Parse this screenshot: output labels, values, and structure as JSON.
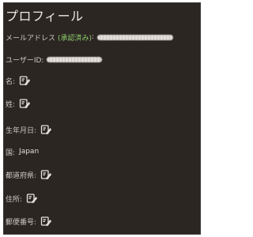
{
  "profile": {
    "title": "プロフィール",
    "email": {
      "label": "メールアドレス",
      "status": "(承認済み)",
      "colon": ":",
      "value_icon": "redacted-value"
    },
    "user_id": {
      "label": "ユーザーID:",
      "value_icon": "redacted-value"
    },
    "fields": [
      {
        "label": "名:",
        "icon": "edit-icon"
      },
      {
        "label": "姓:",
        "icon": "edit-icon"
      },
      {
        "label": "生年月日:",
        "icon": "edit-icon"
      },
      {
        "label": "国:",
        "value": "Japan"
      },
      {
        "label": "都道府県:",
        "icon": "edit-icon"
      },
      {
        "label": "住所:",
        "icon": "edit-icon"
      },
      {
        "label": "郵便番号:",
        "icon": "edit-icon"
      }
    ]
  },
  "colors": {
    "background": "#2c2623",
    "text": "#cfcac6",
    "verified": "#8dcf6b"
  }
}
